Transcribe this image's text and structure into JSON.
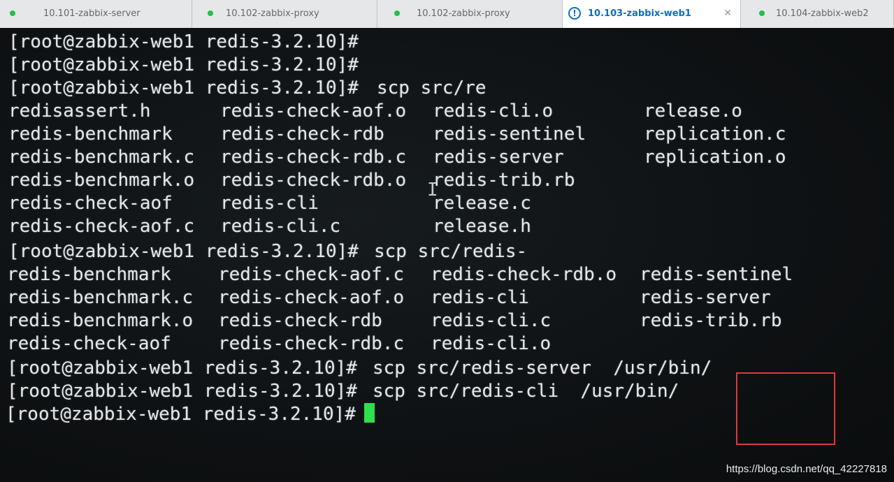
{
  "tabs": [
    {
      "label": "10.101-zabbix-server",
      "active": false
    },
    {
      "label": "10.102-zabbix-proxy",
      "active": false
    },
    {
      "label": "10.102-zabbix-proxy",
      "active": false
    },
    {
      "label": "10.103-zabbix-web1",
      "active": true
    },
    {
      "label": "10.104-zabbix-web2",
      "active": false
    }
  ],
  "terminal": {
    "prompt": "[root@zabbix-web1 redis-3.2.10]#",
    "commands": {
      "cmd3": "scp src/re",
      "cmd10": "scp src/redis-",
      "cmd15": "scp src/redis-server  /usr/bin/",
      "cmd16": "scp src/redis-cli  /usr/bin/"
    },
    "listing1": [
      [
        "redisassert.h",
        "redis-check-aof.o",
        "redis-cli.o",
        "release.o"
      ],
      [
        "redis-benchmark",
        "redis-check-rdb",
        "redis-sentinel",
        "replication.c"
      ],
      [
        "redis-benchmark.c",
        "redis-check-rdb.c",
        "redis-server",
        "replication.o"
      ],
      [
        "redis-benchmark.o",
        "redis-check-rdb.o",
        "redis-trib.rb",
        ""
      ],
      [
        "redis-check-aof",
        "redis-cli",
        "release.c",
        ""
      ],
      [
        "redis-check-aof.c",
        "redis-cli.c",
        "release.h",
        ""
      ]
    ],
    "listing2": [
      [
        "redis-benchmark",
        "redis-check-aof.c",
        "redis-check-rdb.o",
        "redis-sentinel"
      ],
      [
        "redis-benchmark.c",
        "redis-check-aof.o",
        "redis-cli",
        "redis-server"
      ],
      [
        "redis-benchmark.o",
        "redis-check-rdb",
        "redis-cli.c",
        "redis-trib.rb"
      ],
      [
        "redis-check-aof",
        "redis-check-rdb.c",
        "redis-cli.o",
        ""
      ]
    ]
  },
  "watermark": "https://blog.csdn.net/qq_42227818",
  "colors": {
    "terminal_bg": "#0f1214",
    "terminal_fg": "#e4e8ea",
    "cursor": "#2ee04e",
    "highlight_box": "#e0383a",
    "active_tab_text": "#0c6fc2",
    "status_dot": "#21c04a"
  }
}
